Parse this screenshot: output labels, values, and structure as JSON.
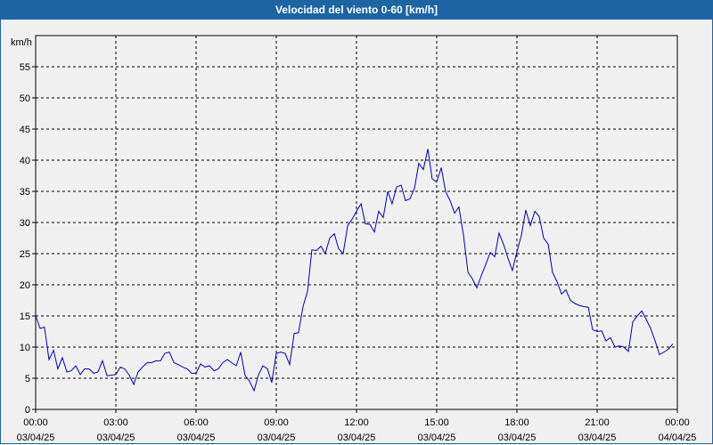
{
  "window": {
    "title": "Velocidad del viento 0-60 [km/h]"
  },
  "chart_data": {
    "type": "line",
    "title": "Velocidad del viento 0-60 [km/h]",
    "ylabel": "km/h",
    "xlabel": "",
    "ylim": [
      0,
      60
    ],
    "xlim": [
      0,
      24
    ],
    "y_ticks": [
      0,
      5,
      10,
      15,
      20,
      25,
      30,
      35,
      40,
      45,
      50,
      55
    ],
    "x_ticks": [
      {
        "value": 0,
        "time": "00:00",
        "date": "03/04/25"
      },
      {
        "value": 3,
        "time": "03:00",
        "date": "03/04/25"
      },
      {
        "value": 6,
        "time": "06:00",
        "date": "03/04/25"
      },
      {
        "value": 9,
        "time": "09:00",
        "date": "03/04/25"
      },
      {
        "value": 12,
        "time": "12:00",
        "date": "03/04/25"
      },
      {
        "value": 15,
        "time": "15:00",
        "date": "03/04/25"
      },
      {
        "value": 18,
        "time": "18:00",
        "date": "03/04/25"
      },
      {
        "value": 21,
        "time": "21:00",
        "date": "03/04/25"
      },
      {
        "value": 24,
        "time": "00:00",
        "date": "04/04/25"
      }
    ],
    "grid": true,
    "line_color": "#0000c0",
    "series": [
      {
        "x": [
          0.0,
          0.17,
          0.33,
          0.5,
          0.67,
          0.83,
          1.0,
          1.17,
          1.33,
          1.5,
          1.67,
          1.83,
          2.0,
          2.17,
          2.33,
          2.5,
          2.67,
          2.83,
          3.0,
          3.17,
          3.33,
          3.5,
          3.67,
          3.83,
          4.0,
          4.17,
          4.33,
          4.5,
          4.67,
          4.83,
          5.0,
          5.17,
          5.33,
          5.5,
          5.67,
          5.83,
          6.0,
          6.17,
          6.33,
          6.5,
          6.67,
          6.83,
          7.0,
          7.17,
          7.33,
          7.5,
          7.67,
          7.83,
          8.0,
          8.17,
          8.33,
          8.5,
          8.67,
          8.83,
          9.0,
          9.17,
          9.33,
          9.5,
          9.67,
          9.83,
          10.0,
          10.17,
          10.33,
          10.5,
          10.67,
          10.83,
          11.0,
          11.17,
          11.33,
          11.5,
          11.67,
          11.83,
          12.0,
          12.17,
          12.33,
          12.5,
          12.67,
          12.83,
          13.0,
          13.17,
          13.33,
          13.5,
          13.67,
          13.83,
          14.0,
          14.17,
          14.33,
          14.5,
          14.67,
          14.83,
          15.0,
          15.17,
          15.33,
          15.5,
          15.67,
          15.83,
          16.0,
          16.17,
          16.33,
          16.5,
          16.67,
          16.83,
          17.0,
          17.17,
          17.33,
          17.5,
          17.67,
          17.83,
          18.0,
          18.17,
          18.33,
          18.5,
          18.67,
          18.83,
          19.0,
          19.17,
          19.33,
          19.5,
          19.67,
          19.83,
          20.0,
          20.17,
          20.33,
          20.5,
          20.67,
          20.83,
          21.0,
          21.17,
          21.33,
          21.5,
          21.67,
          21.83,
          22.0,
          22.17,
          22.33,
          22.5,
          22.67,
          22.83,
          23.0,
          23.17,
          23.33,
          23.5,
          23.67,
          23.83
        ],
        "values": [
          15.0,
          13.0,
          13.2,
          8.0,
          9.5,
          6.5,
          8.3,
          6.0,
          6.2,
          7.0,
          5.6,
          6.5,
          6.5,
          5.8,
          6.0,
          7.8,
          5.4,
          5.5,
          5.6,
          6.8,
          6.5,
          5.5,
          4.0,
          6.0,
          6.8,
          7.5,
          7.5,
          7.8,
          7.8,
          9.0,
          9.2,
          7.5,
          7.2,
          6.8,
          6.5,
          5.8,
          5.8,
          7.3,
          6.8,
          7.0,
          6.2,
          6.5,
          7.5,
          8.0,
          7.5,
          7.0,
          9.2,
          5.5,
          4.5,
          3.0,
          5.5,
          7.0,
          6.5,
          4.3,
          9.0,
          9.2,
          9.0,
          7.2,
          12.2,
          12.3,
          16.5,
          19.0,
          25.6,
          25.5,
          26.2,
          25.0,
          27.5,
          28.2,
          25.8,
          25.0,
          29.5,
          30.5,
          31.8,
          33.0,
          29.8,
          29.7,
          28.5,
          31.8,
          30.8,
          35.0,
          33.0,
          35.7,
          36.0,
          33.5,
          33.8,
          35.5,
          39.5,
          38.5,
          41.8,
          37.0,
          36.5,
          38.8,
          35.0,
          33.5,
          31.5,
          32.5,
          28.0,
          22.0,
          21.0,
          19.5,
          21.5,
          23.2,
          25.2,
          24.5,
          28.3,
          26.5,
          24.2,
          22.3,
          25.3,
          28.0,
          32.0,
          29.5,
          31.8,
          31.0,
          27.5,
          26.5,
          22.0,
          20.5,
          18.5,
          19.2,
          17.5,
          17.0,
          16.7,
          16.5,
          16.4,
          12.8,
          12.5,
          12.6,
          11.0,
          11.5,
          10.0,
          10.2,
          10.0,
          9.3,
          14.0,
          15.0,
          15.8,
          14.5,
          13.0,
          11.0,
          8.8,
          9.2,
          9.7,
          10.5
        ]
      }
    ]
  }
}
